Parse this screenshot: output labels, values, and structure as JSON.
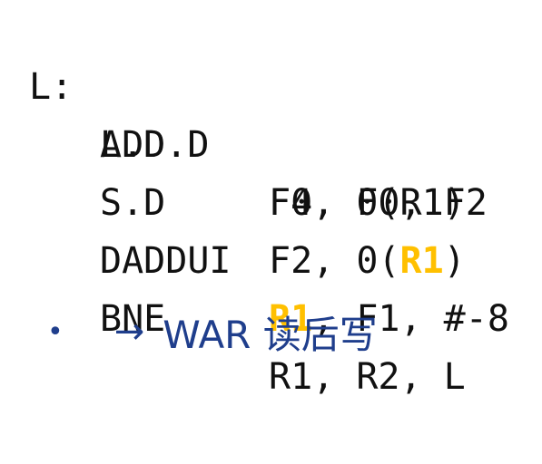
{
  "code": {
    "label": "L:",
    "lines": [
      {
        "op": "L.D",
        "args": [
          {
            "t": "F0, 0(R1)"
          }
        ]
      },
      {
        "op": "ADD.D",
        "args": [
          {
            "t": "F4, F0, F2"
          }
        ]
      },
      {
        "op": "S.D",
        "args": [
          {
            "t": "F2, 0("
          },
          {
            "t": "R1",
            "hl": true
          },
          {
            "t": ")"
          }
        ]
      },
      {
        "op": "DADDUI",
        "args": [
          {
            "t": "R1",
            "hl": true
          },
          {
            "t": ", F1, #-8"
          }
        ]
      },
      {
        "op": "BNE",
        "args": [
          {
            "t": "R1, R2, L"
          }
        ]
      }
    ]
  },
  "bullet": {
    "marker": "•",
    "arrow": "→",
    "text": "WAR 读后写"
  },
  "colors": {
    "code": "#111111",
    "highlight": "#FFC000",
    "bullet": "#1F3E8C"
  }
}
